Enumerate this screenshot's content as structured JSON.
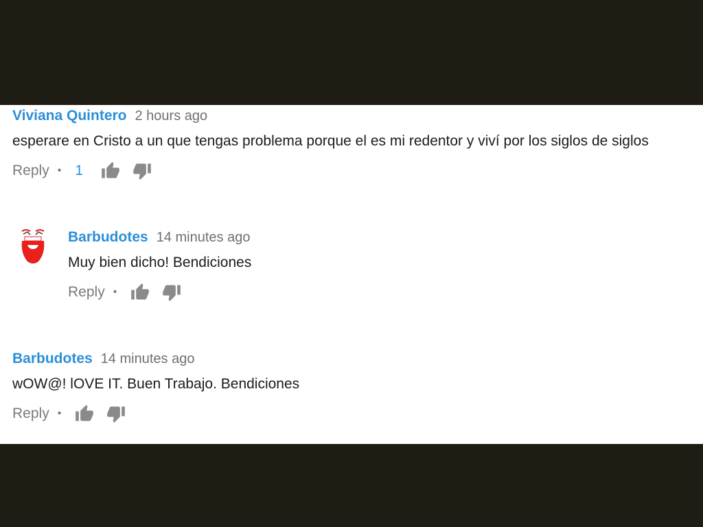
{
  "comments": [
    {
      "author": "Viviana Quintero",
      "time": "2 hours ago",
      "text": "esperare en Cristo a un que tengas problema porque el es mi redentor y viví por los siglos de siglos",
      "reply_label": "Reply",
      "like_count": "1"
    }
  ],
  "reply": {
    "author": "Barbudotes",
    "time": "14 minutes ago",
    "text": "Muy bien dicho! Bendiciones",
    "reply_label": "Reply",
    "avatar_icon": "barbudotes-logo",
    "avatar_color": "#e8211c"
  },
  "comment2": {
    "author": "Barbudotes",
    "time": "14 minutes ago",
    "text": "wOW@! lOVE IT. Buen Trabajo. Bendiciones",
    "reply_label": "Reply"
  },
  "colors": {
    "author": "#2b8fd8",
    "meta": "#6f6f6f",
    "background_bar": "#1f1c13"
  },
  "icons": {
    "like": "thumbs-up-icon",
    "dislike": "thumbs-down-icon"
  }
}
